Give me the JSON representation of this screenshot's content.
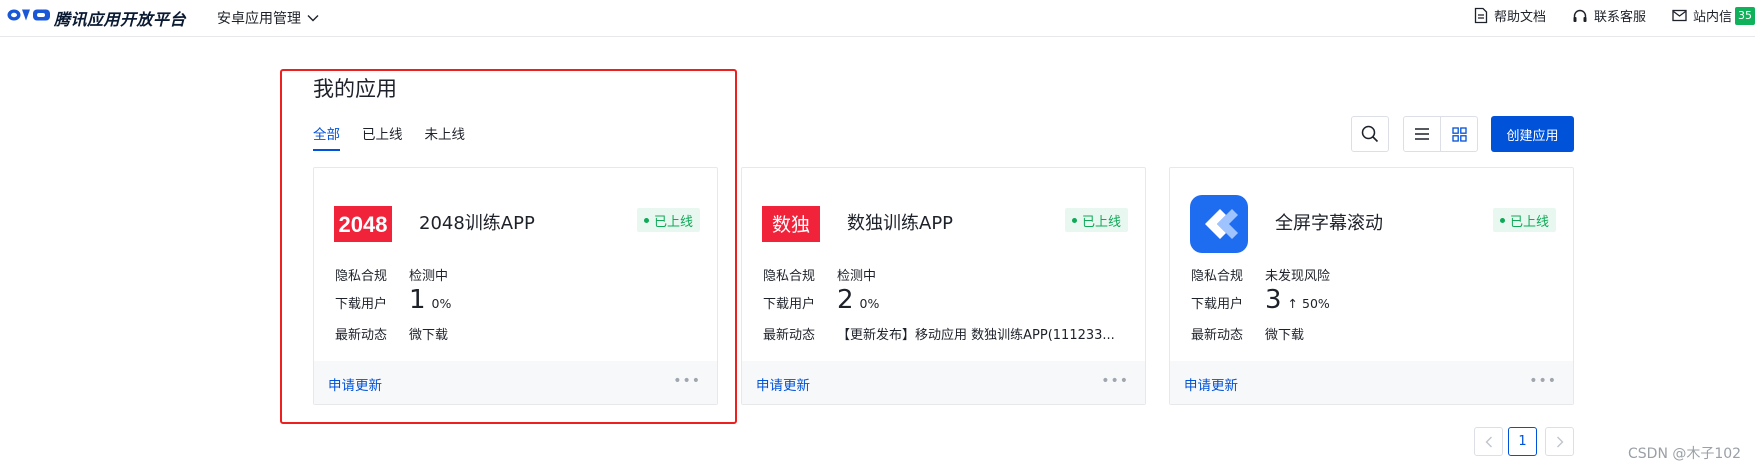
{
  "topbar": {
    "brand": "腾讯应用开放平台",
    "nav_menu": "安卓应用管理",
    "help_docs": "帮助文档",
    "contact_service": "联系客服",
    "inbox": "站内信",
    "inbox_count": "35"
  },
  "page": {
    "title": "我的应用",
    "tabs": [
      {
        "label": "全部",
        "active": true
      },
      {
        "label": "已上线",
        "active": false
      },
      {
        "label": "未上线",
        "active": false
      }
    ],
    "create_button": "创建应用"
  },
  "cards": [
    {
      "logo_text": "2048",
      "logo_color": "#f0233a",
      "name": "2048训练APP",
      "status": "已上线",
      "privacy_label": "隐私合规",
      "privacy_value": "检测中",
      "downloads_label": "下载用户",
      "downloads": "1",
      "downloads_change": "0%",
      "activity_label": "最新动态",
      "activity_value": "微下载",
      "footer_action": "申请更新",
      "more_icon": "ellipsis-icon"
    },
    {
      "logo_text": "数独",
      "logo_color": "#f0233a",
      "name": "数独训练APP",
      "status": "已上线",
      "privacy_label": "隐私合规",
      "privacy_value": "检测中",
      "downloads_label": "下载用户",
      "downloads": "2",
      "downloads_change": "0%",
      "activity_label": "最新动态",
      "activity_value": "【更新发布】移动应用 数独训练APP(111233...",
      "footer_action": "申请更新",
      "more_icon": "ellipsis-icon"
    },
    {
      "logo_icon": "double-chevron-icon",
      "logo_color": "#1e6cf0",
      "name": "全屏字幕滚动",
      "status": "已上线",
      "privacy_label": "隐私合规",
      "privacy_value": "未发现风险",
      "downloads_label": "下载用户",
      "downloads": "3",
      "downloads_change": "↑ 50%",
      "activity_label": "最新动态",
      "activity_value": "微下载",
      "footer_action": "申请更新",
      "more_icon": "ellipsis-icon"
    }
  ],
  "pagination": {
    "current": "1",
    "prev_icon": "chevron-left-icon",
    "next_icon": "chevron-right-icon"
  },
  "watermark": "CSDN @木子102",
  "colors": {
    "accent": "#0052d9",
    "success": "#0fa958",
    "highlight": "#ee1f1f"
  }
}
